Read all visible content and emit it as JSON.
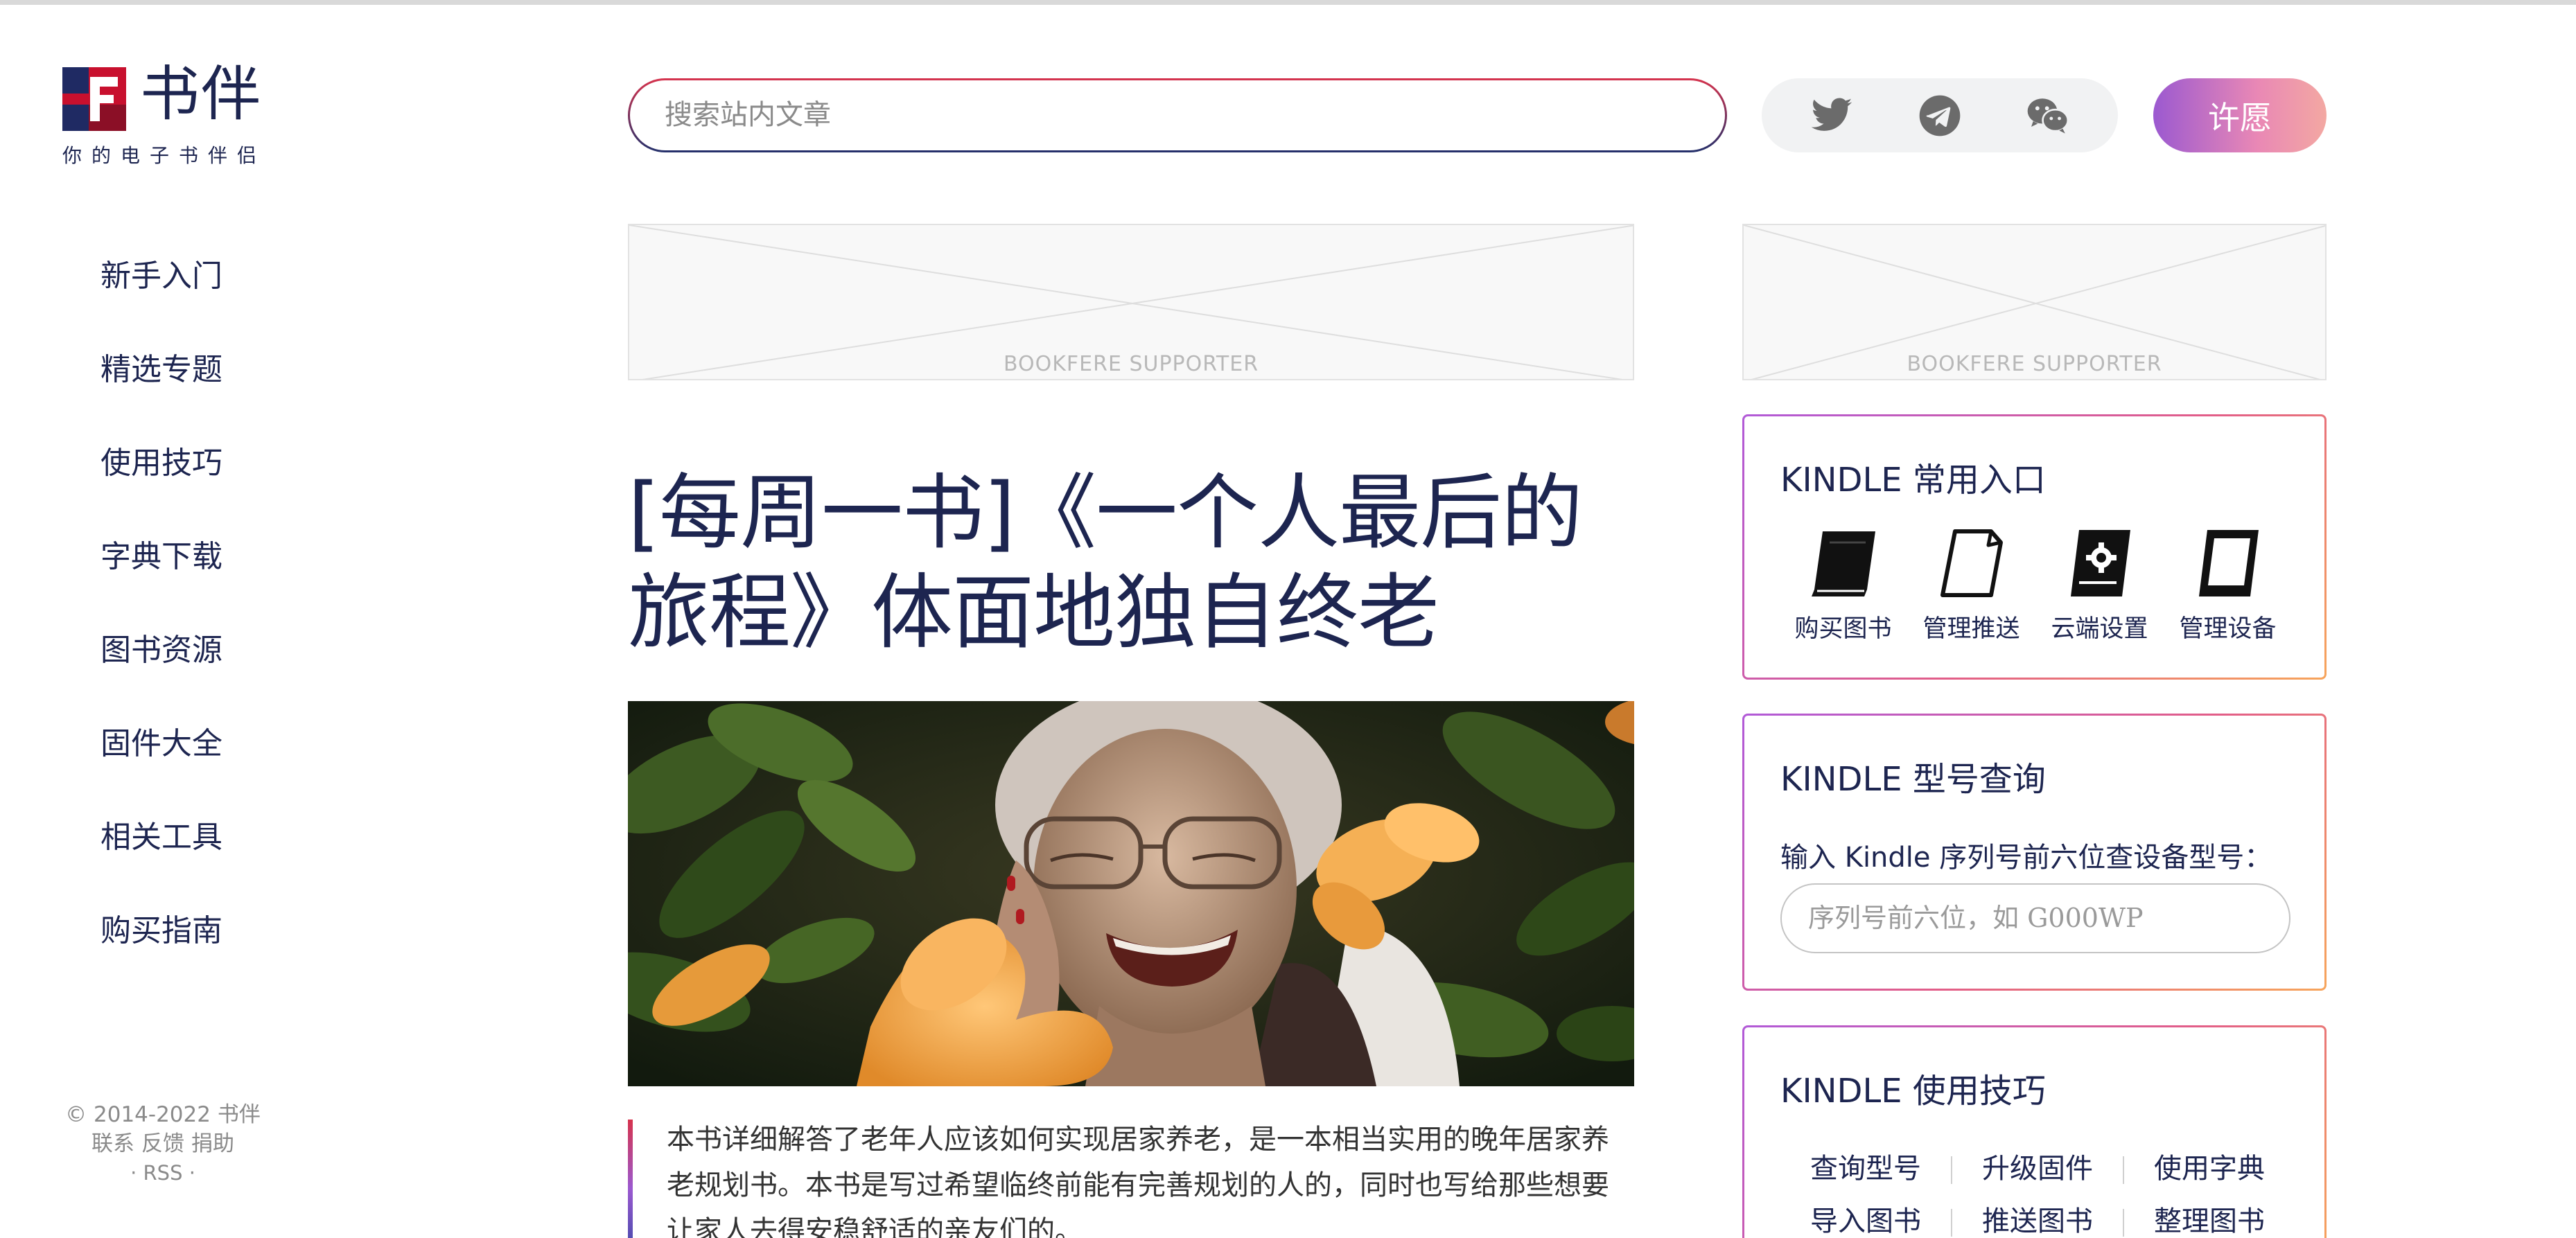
{
  "site": {
    "logo_title": "书伴",
    "logo_subtitle": "你的电子书伴侣"
  },
  "nav": {
    "items": [
      {
        "label": "新手入门"
      },
      {
        "label": "精选专题"
      },
      {
        "label": "使用技巧"
      },
      {
        "label": "字典下载"
      },
      {
        "label": "图书资源"
      },
      {
        "label": "固件大全"
      },
      {
        "label": "相关工具"
      },
      {
        "label": "购买指南"
      }
    ]
  },
  "footer": {
    "copyright": "© 2014-2022 书伴",
    "links": [
      "联系",
      "反馈",
      "捐助"
    ],
    "rss": "· RSS ·"
  },
  "header": {
    "search_placeholder": "搜索站内文章",
    "social_icons": [
      "twitter-icon",
      "telegram-icon",
      "wechat-icon"
    ],
    "wish_button": "许愿"
  },
  "ads": {
    "main_label": "BOOKFERE SUPPORTER",
    "side_label": "BOOKFERE SUPPORTER"
  },
  "article": {
    "title": "[每周一书]《一个人最后的旅程》体面地独自终老",
    "excerpt": "本书详细解答了老年人应该如何实现居家养老，是一本相当实用的晚年居家养老规划书。本书是写过希望临终前能有完善规划的人的，同时也写给那些想要让家人去得安稳舒适的亲友们的。"
  },
  "widgets": {
    "kindle": {
      "title": "KINDLE 常用入口",
      "items": [
        {
          "label": "购买图书",
          "icon": "book-icon"
        },
        {
          "label": "管理推送",
          "icon": "document-icon"
        },
        {
          "label": "云端设置",
          "icon": "cloud-settings-icon"
        },
        {
          "label": "管理设备",
          "icon": "device-icon"
        }
      ]
    },
    "model": {
      "title": "KINDLE 型号查询",
      "description": "输入 Kindle 序列号前六位查设备型号：",
      "serial_placeholder": "序列号前六位，如 G000WP"
    },
    "tips": {
      "title": "KINDLE 使用技巧",
      "rows": [
        [
          "查询型号",
          "升级固件",
          "使用字典"
        ],
        [
          "导入图书",
          "推送图书",
          "整理图书"
        ]
      ]
    }
  },
  "colors": {
    "brand_navy": "#1d2550",
    "brand_red": "#d6334d",
    "wish_gradient_start": "#9b59d0",
    "wish_gradient_end": "#f3a8a2"
  }
}
